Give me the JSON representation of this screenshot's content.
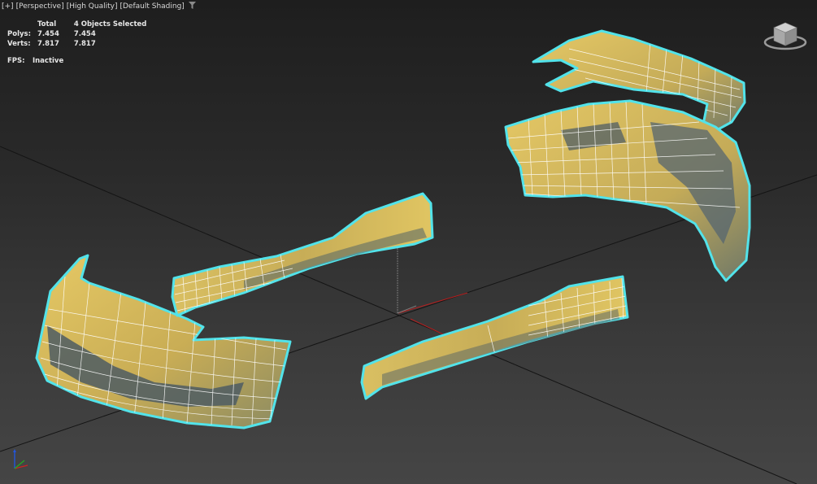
{
  "viewport": {
    "labels": [
      "[+]",
      "[Perspective]",
      "[High Quality]",
      "[Default Shading]"
    ],
    "filter_icon": "filter-icon"
  },
  "stats": {
    "col_total": "Total",
    "col_selected": "4 Objects Selected",
    "polys_label": "Polys:",
    "polys_total": "7.454",
    "polys_selected": "7.454",
    "verts_label": "Verts:",
    "verts_total": "7.817",
    "verts_selected": "7.817"
  },
  "fps": {
    "label": "FPS:",
    "value": "Inactive"
  },
  "colors": {
    "mesh_fill": "#d7bc5e",
    "mesh_shadow": "#4b5a66",
    "selection_outline": "#52e3ea",
    "wire": "#ffffff",
    "grid_line": "#141414",
    "axis_x": "#cc2222",
    "axis_y": "#22aa22",
    "axis_z": "#2255dd"
  },
  "icons": {
    "viewcube": "viewcube-icon",
    "tripod": "axis-tripod-icon"
  }
}
